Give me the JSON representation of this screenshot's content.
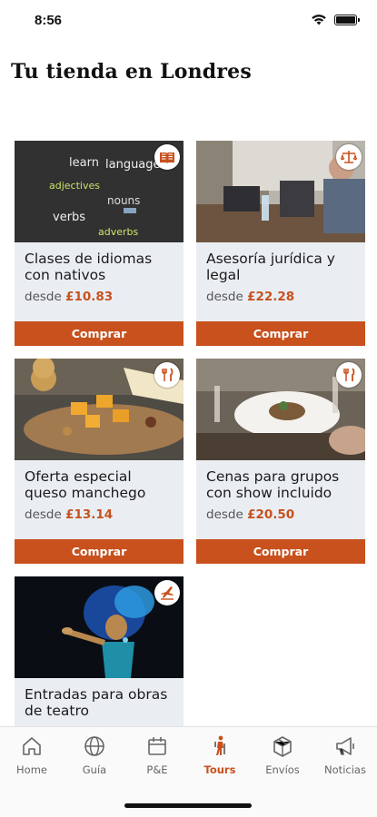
{
  "status": {
    "time": "8:56"
  },
  "page": {
    "title": "Tu tienda en Londres"
  },
  "colors": {
    "accent": "#c8511d",
    "card_bg": "#eaeef3"
  },
  "products": [
    {
      "title": "Clases de idiomas con nativos",
      "price_prefix": "desde",
      "price": "£10.83",
      "button": "Comprar",
      "badge_icon": "book-icon"
    },
    {
      "title": "Asesoría jurídica y legal",
      "price_prefix": "desde",
      "price": "£22.28",
      "button": "Comprar",
      "badge_icon": "scales-icon"
    },
    {
      "title": "Oferta especial queso manchego",
      "price_prefix": "desde",
      "price": "£13.14",
      "button": "Comprar",
      "badge_icon": "utensils-icon"
    },
    {
      "title": "Cenas para grupos con show incluido",
      "price_prefix": "desde",
      "price": "£20.50",
      "button": "Comprar",
      "badge_icon": "utensils-icon"
    },
    {
      "title": "Entradas para obras de teatro",
      "badge_icon": "plane-icon"
    }
  ],
  "tabs": [
    {
      "label": "Home",
      "icon": "home-icon"
    },
    {
      "label": "Guía",
      "icon": "globe-icon"
    },
    {
      "label": "P&E",
      "icon": "calendar-icon"
    },
    {
      "label": "Tours",
      "icon": "walking-person-icon",
      "active": true
    },
    {
      "label": "Envíos",
      "icon": "box-icon"
    },
    {
      "label": "Noticias",
      "icon": "megaphone-icon"
    }
  ]
}
